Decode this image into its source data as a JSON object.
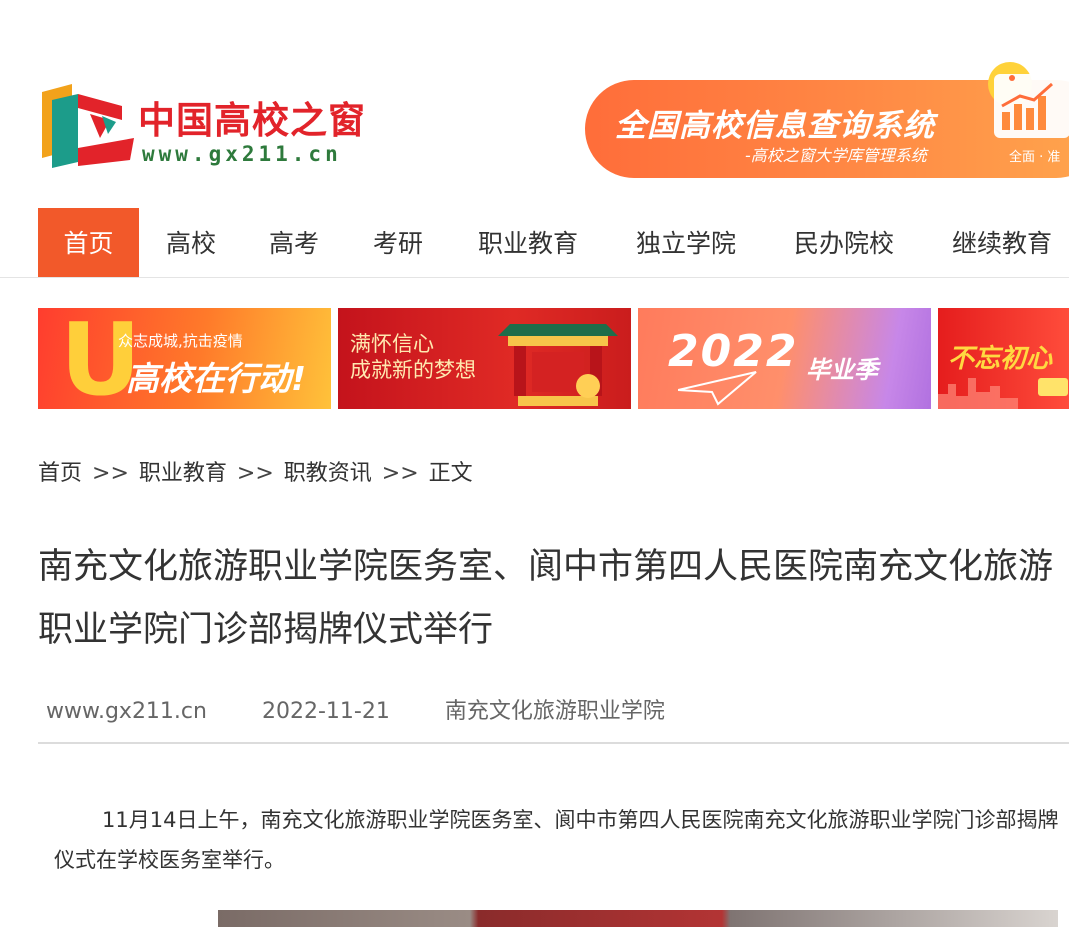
{
  "header": {
    "logo": {
      "title": "中国高校之窗",
      "url": "www.gx211.cn"
    },
    "ad": {
      "title": "全国高校信息查询系统",
      "subtitle": "-高校之窗大学库管理系统",
      "badge": "全面 · 准"
    }
  },
  "nav": {
    "items": [
      "首页",
      "高校",
      "高考",
      "考研",
      "职业教育",
      "独立学院",
      "民办院校",
      "继续教育"
    ],
    "active_index": 0,
    "accent": "#f2592a"
  },
  "promos": [
    {
      "line1": "众志成城,抗击疫情",
      "line2": "高校在行动!"
    },
    {
      "line1": "满怀信心",
      "line2": "成就新的梦想"
    },
    {
      "line1": "2022",
      "line2": "毕业季"
    },
    {
      "line1": "不忘初心"
    }
  ],
  "breadcrumb": {
    "items": [
      "首页",
      "职业教育",
      "职教资讯",
      "正文"
    ],
    "separator": ">>"
  },
  "article": {
    "title": "南充文化旅游职业学院医务室、阆中市第四人民医院南充文化旅游职业学院门诊部揭牌仪式举行",
    "source_site": "www.gx211.cn",
    "date": "2022-11-21",
    "author": "南充文化旅游职业学院",
    "paragraph_1": "11月14日上午，南充文化旅游职业学院医务室、阆中市第四人民医院南充文化旅游职业学院门诊部揭牌仪式在学校医务室举行。"
  }
}
